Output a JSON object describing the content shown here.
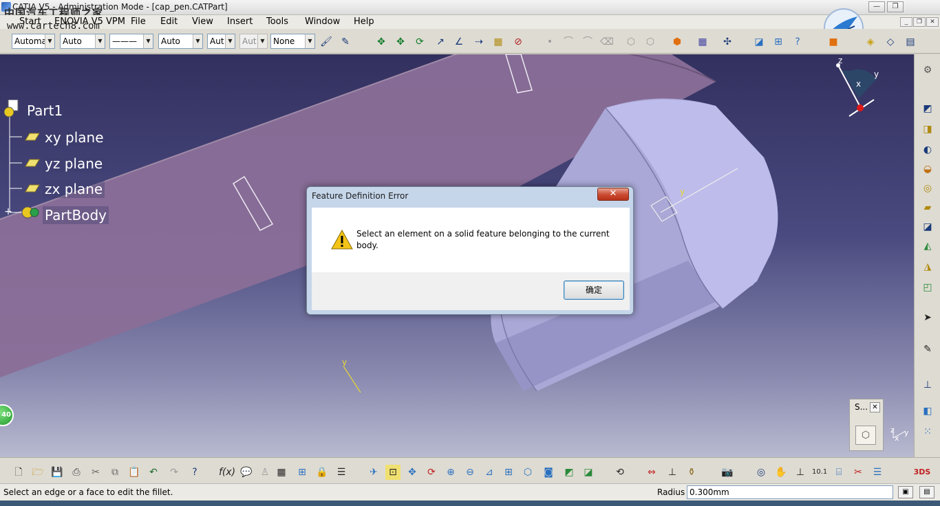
{
  "window": {
    "title": "CATIA V5 - Administration Mode - [cap_pen.CATPart]",
    "watermark_line1": "中国汽车工程师之家",
    "watermark_line2": "www.cartech8.com"
  },
  "menu": {
    "start": "Start",
    "enovia": "ENOVIA V5 VPM",
    "file": "File",
    "edit": "Edit",
    "view": "View",
    "insert": "Insert",
    "tools": "Tools",
    "window": "Window",
    "help": "Help"
  },
  "toolbar": {
    "combos": [
      "Automa",
      "Auto",
      "———",
      "Auto",
      "Aut",
      "Aut",
      "None"
    ]
  },
  "tree": {
    "root": "Part1",
    "items": [
      "xy plane",
      "yz plane",
      "zx plane",
      "PartBody"
    ]
  },
  "compass": {
    "z": "z",
    "x": "x",
    "y": "y"
  },
  "axis_small": {
    "y": "y",
    "x": "x",
    "z": "z"
  },
  "side_ball": "40",
  "small_toolbar": {
    "label": "S..."
  },
  "dialog": {
    "title": "Feature Definition Error",
    "close": "✕",
    "message": "Select an element on a solid feature belonging to the current body.",
    "ok": "确定"
  },
  "status": {
    "message": "Select an edge or a face to edit the fillet.",
    "radius_label": "Radius",
    "radius_value": "0.300mm"
  },
  "colors": {
    "viewport_top": "#32305e",
    "viewport_bottom": "#b8bad0",
    "pen_body": "#a6a4d0",
    "clip": "#8a6f98",
    "tree_text": "#ffffff",
    "warning": "#f2c417"
  }
}
